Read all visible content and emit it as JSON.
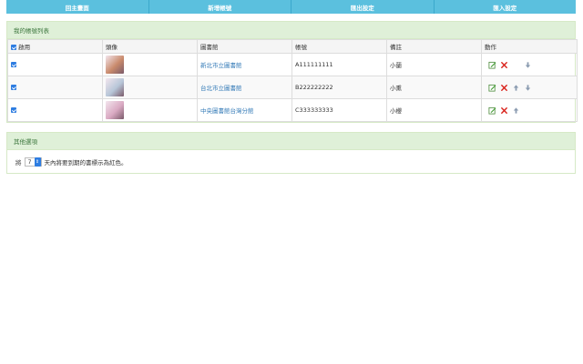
{
  "nav": {
    "home": "回主畫面",
    "add_account": "新增帳號",
    "export_settings": "匯出設定",
    "import_settings": "匯入設定"
  },
  "accounts_panel": {
    "title": "我的帳號列表",
    "columns": {
      "enabled": "啟用",
      "avatar": "頭像",
      "library": "圖書館",
      "account": "帳號",
      "note": "備註",
      "actions": "動作"
    },
    "rows": [
      {
        "enabled": true,
        "library": "新北市立圖書館",
        "account": "A111111111",
        "note": "小蘭",
        "avatar_color": "#c98a6b",
        "can_up": false,
        "can_down": true
      },
      {
        "enabled": true,
        "library": "台北市立圖書館",
        "account": "B222222222",
        "note": "小熏",
        "avatar_color": "#b7c6d8",
        "can_up": true,
        "can_down": true
      },
      {
        "enabled": true,
        "library": "中央圖書館台灣分館",
        "account": "C333333333",
        "note": "小櫻",
        "avatar_color": "#d9a9c2",
        "can_up": true,
        "can_down": false
      }
    ]
  },
  "options_panel": {
    "title": "其他選項",
    "prefix": "將",
    "days": "7",
    "suffix": "天內將要到期的書標示為紅色。"
  },
  "colors": {
    "nav": "#5bc0de",
    "panel_heading": "#dff0d8",
    "link": "#337ab7",
    "checkbox": "#2e7de1"
  }
}
